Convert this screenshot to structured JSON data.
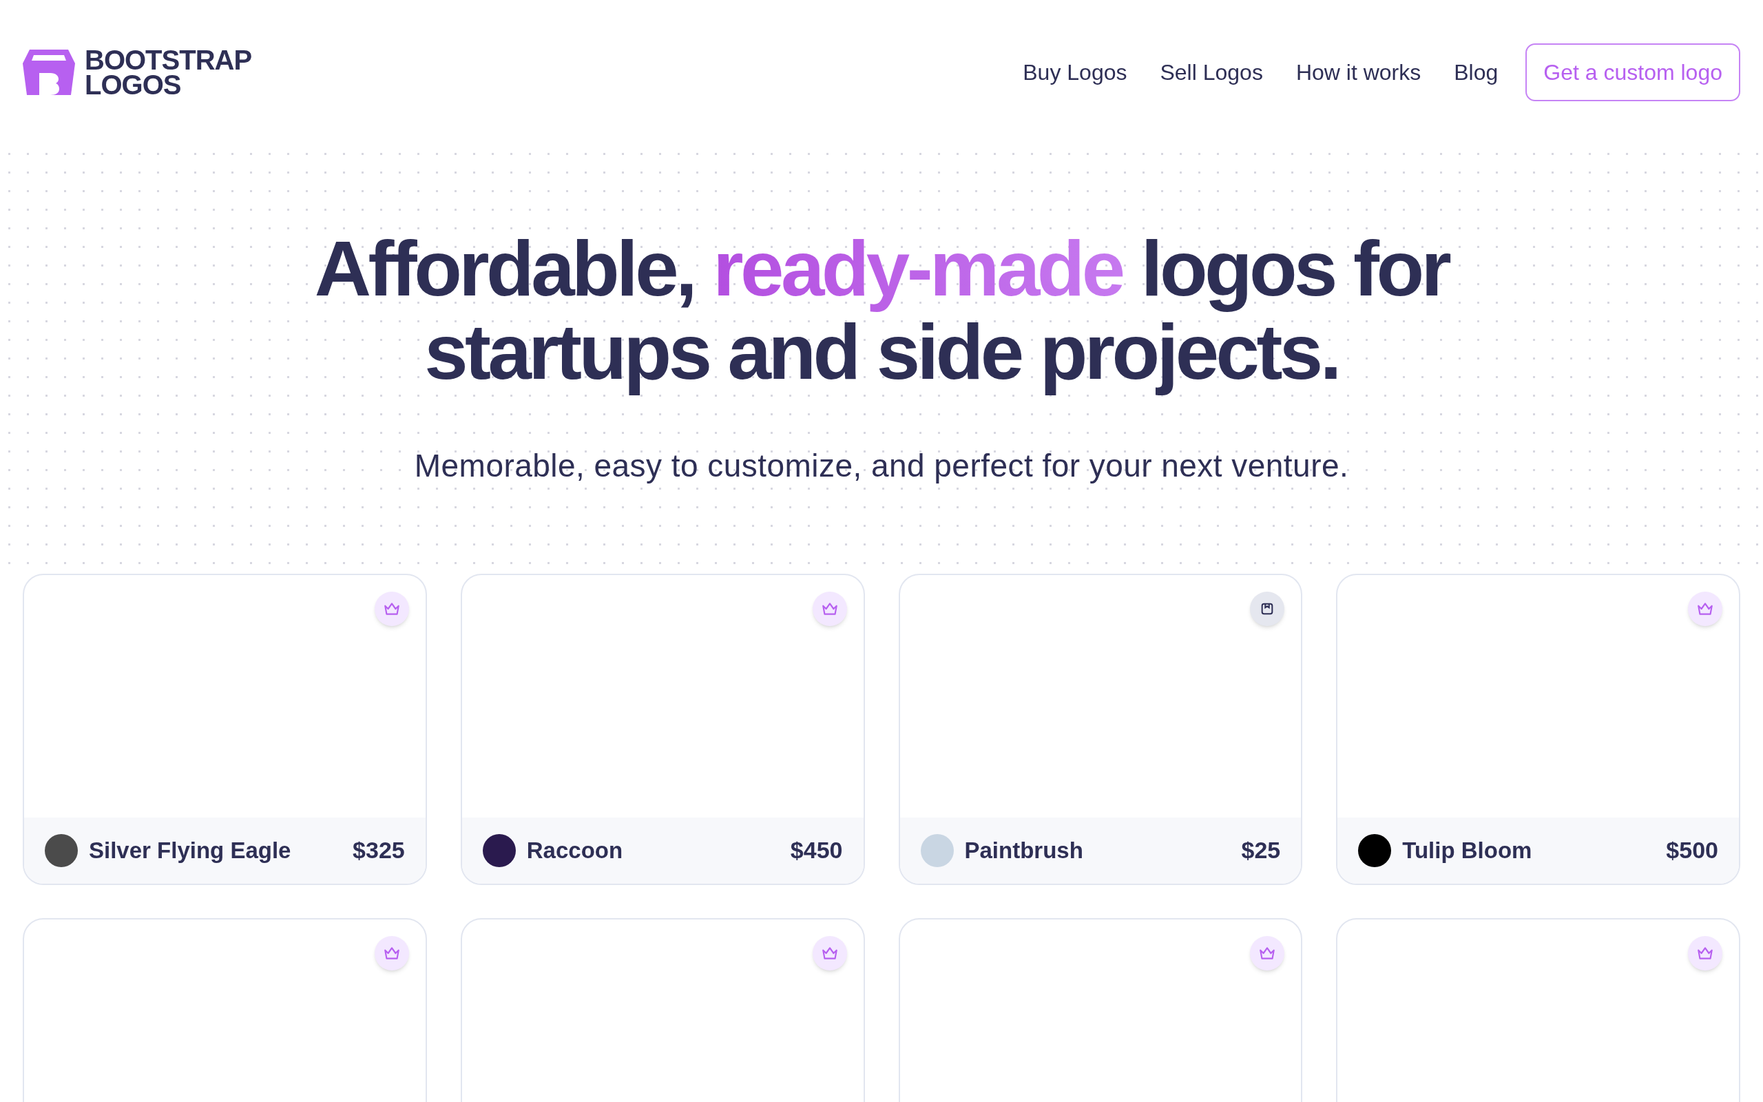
{
  "brand": {
    "line_1": "BOOTSTRAP",
    "line_2": "LOGOS"
  },
  "nav": {
    "links": [
      "Buy Logos",
      "Sell Logos",
      "How it works",
      "Blog"
    ],
    "cta": "Get a custom logo"
  },
  "hero": {
    "headline": [
      {
        "text": "Affordable,",
        "highlight": false
      },
      {
        "text": "ready-made",
        "highlight": true
      },
      {
        "text": "logos for startups and side projects.",
        "highlight": false
      }
    ],
    "subtitle": "Memorable, easy to customize, and perfect for your next venture."
  },
  "cards": [
    {
      "kind": "crown",
      "name": "Silver Flying Eagle",
      "price": "$325",
      "color": "#4b4b4b"
    },
    {
      "kind": "crown",
      "name": "Raccoon",
      "price": "$450",
      "color": "#2a1a4e"
    },
    {
      "kind": "box",
      "name": "Paintbrush",
      "price": "$25",
      "color": "#c9d6e3"
    },
    {
      "kind": "crown",
      "name": "Tulip Bloom",
      "price": "$500",
      "color": "#000000"
    },
    {
      "kind": "crown"
    },
    {
      "kind": "crown"
    },
    {
      "kind": "crown"
    },
    {
      "kind": "crown"
    }
  ]
}
